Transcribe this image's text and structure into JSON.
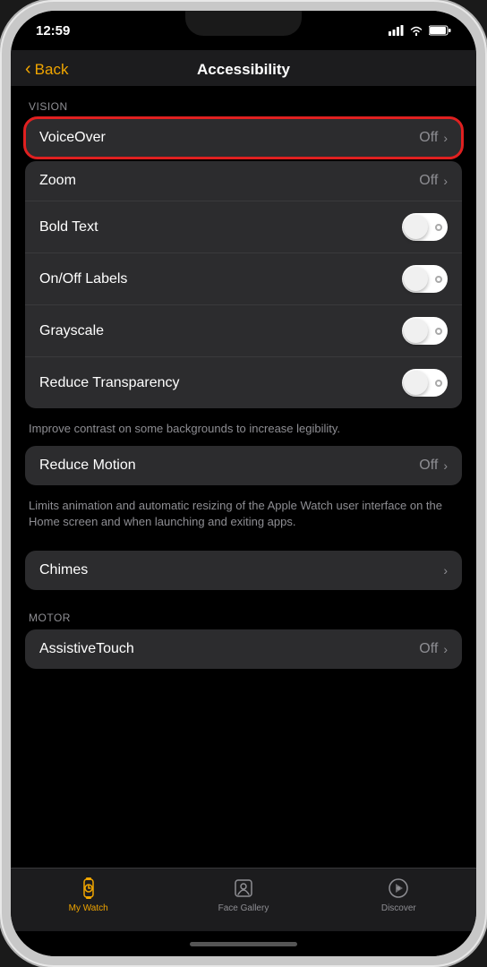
{
  "status": {
    "time": "12:59",
    "location_icon": "▶"
  },
  "nav": {
    "back_label": "Back",
    "title": "Accessibility"
  },
  "sections": {
    "vision": {
      "header": "VISION",
      "items": [
        {
          "id": "voiceover",
          "label": "VoiceOver",
          "value": "Off",
          "type": "navigation",
          "highlighted": true
        },
        {
          "id": "zoom",
          "label": "Zoom",
          "value": "Off",
          "type": "navigation",
          "highlighted": false
        },
        {
          "id": "bold-text",
          "label": "Bold Text",
          "value": "",
          "type": "toggle",
          "highlighted": false
        },
        {
          "id": "onoff-labels",
          "label": "On/Off Labels",
          "value": "",
          "type": "toggle",
          "highlighted": false
        },
        {
          "id": "grayscale",
          "label": "Grayscale",
          "value": "",
          "type": "toggle",
          "highlighted": false
        },
        {
          "id": "reduce-transparency",
          "label": "Reduce Transparency",
          "value": "",
          "type": "toggle",
          "highlighted": false
        }
      ],
      "description": "Improve contrast on some backgrounds to increase legibility."
    },
    "motion": {
      "items": [
        {
          "id": "reduce-motion",
          "label": "Reduce Motion",
          "value": "Off",
          "type": "navigation"
        }
      ],
      "description": "Limits animation and automatic resizing of the Apple Watch user interface on the Home screen and when launching and exiting apps."
    },
    "chimes": {
      "items": [
        {
          "id": "chimes",
          "label": "Chimes",
          "value": "",
          "type": "navigation"
        }
      ]
    },
    "motor": {
      "header": "MOTOR",
      "items": [
        {
          "id": "assistive-touch",
          "label": "AssistiveTouch",
          "value": "Off",
          "type": "navigation"
        }
      ]
    }
  },
  "tab_bar": {
    "tabs": [
      {
        "id": "my-watch",
        "label": "My Watch",
        "active": true
      },
      {
        "id": "face-gallery",
        "label": "Face Gallery",
        "active": false
      },
      {
        "id": "discover",
        "label": "Discover",
        "active": false
      }
    ]
  },
  "colors": {
    "accent": "#f0a500",
    "highlight_red": "#e02020",
    "text_primary": "#ffffff",
    "text_secondary": "#8e8e93",
    "bg_card": "#2c2c2e",
    "bg_screen": "#1c1c1e"
  }
}
